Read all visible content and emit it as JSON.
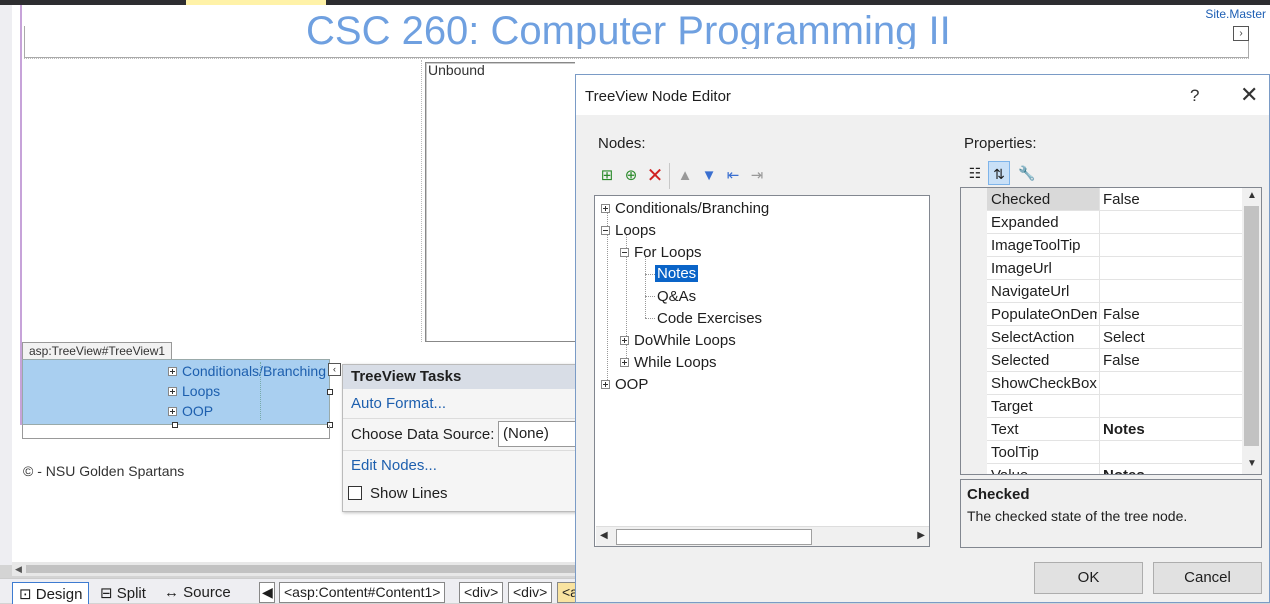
{
  "designer": {
    "site_master": "Site.Master",
    "page_title": "CSC 260: Computer Programming II",
    "unbound": "Unbound",
    "control_tag": "asp:TreeView#TreeView1",
    "tree_preview": [
      "Conditionals/Branching",
      "Loops",
      "OOP"
    ],
    "footer": "© - NSU Golden Spartans",
    "expand_icon": "chevron-right-icon"
  },
  "tasks": {
    "title": "TreeView Tasks",
    "auto_format": "Auto Format...",
    "choose_ds_label": "Choose Data Source:",
    "choose_ds_value": "(None)",
    "edit_nodes": "Edit Nodes...",
    "show_lines": "Show Lines",
    "show_lines_checked": false
  },
  "viewbar": {
    "design": "Design",
    "split": "Split",
    "source": "Source",
    "breadcrumbs": [
      "<asp:Content#Content1>",
      "<div>",
      "<div>",
      "<a"
    ]
  },
  "dialog": {
    "title": "TreeView Node Editor",
    "help": "?",
    "close": "✕",
    "nodes_label": "Nodes:",
    "properties_label": "Properties:",
    "tree": {
      "conditionals": "Conditionals/Branching",
      "loops": "Loops",
      "for_loops": "For Loops",
      "notes": "Notes",
      "qas": "Q&As",
      "code_exercises": "Code Exercises",
      "dowhile": "DoWhile Loops",
      "while": "While Loops",
      "oop": "OOP"
    },
    "properties": [
      {
        "name": "Checked",
        "value": "False"
      },
      {
        "name": "Expanded",
        "value": ""
      },
      {
        "name": "ImageToolTip",
        "value": ""
      },
      {
        "name": "ImageUrl",
        "value": ""
      },
      {
        "name": "NavigateUrl",
        "value": ""
      },
      {
        "name": "PopulateOnDemand",
        "value": "False"
      },
      {
        "name": "SelectAction",
        "value": "Select"
      },
      {
        "name": "Selected",
        "value": "False"
      },
      {
        "name": "ShowCheckBox",
        "value": ""
      },
      {
        "name": "Target",
        "value": ""
      },
      {
        "name": "Text",
        "value": "Notes"
      },
      {
        "name": "ToolTip",
        "value": ""
      },
      {
        "name": "Value",
        "value": "Notes"
      }
    ],
    "description": {
      "title": "Checked",
      "text": "The checked state of the tree node."
    },
    "ok": "OK",
    "cancel": "Cancel"
  },
  "colors": {
    "accent": "#0a64c8",
    "link": "#1d5fae",
    "tree_preview_bg": "#a9cff0",
    "title_blue": "#6fa0e0"
  }
}
